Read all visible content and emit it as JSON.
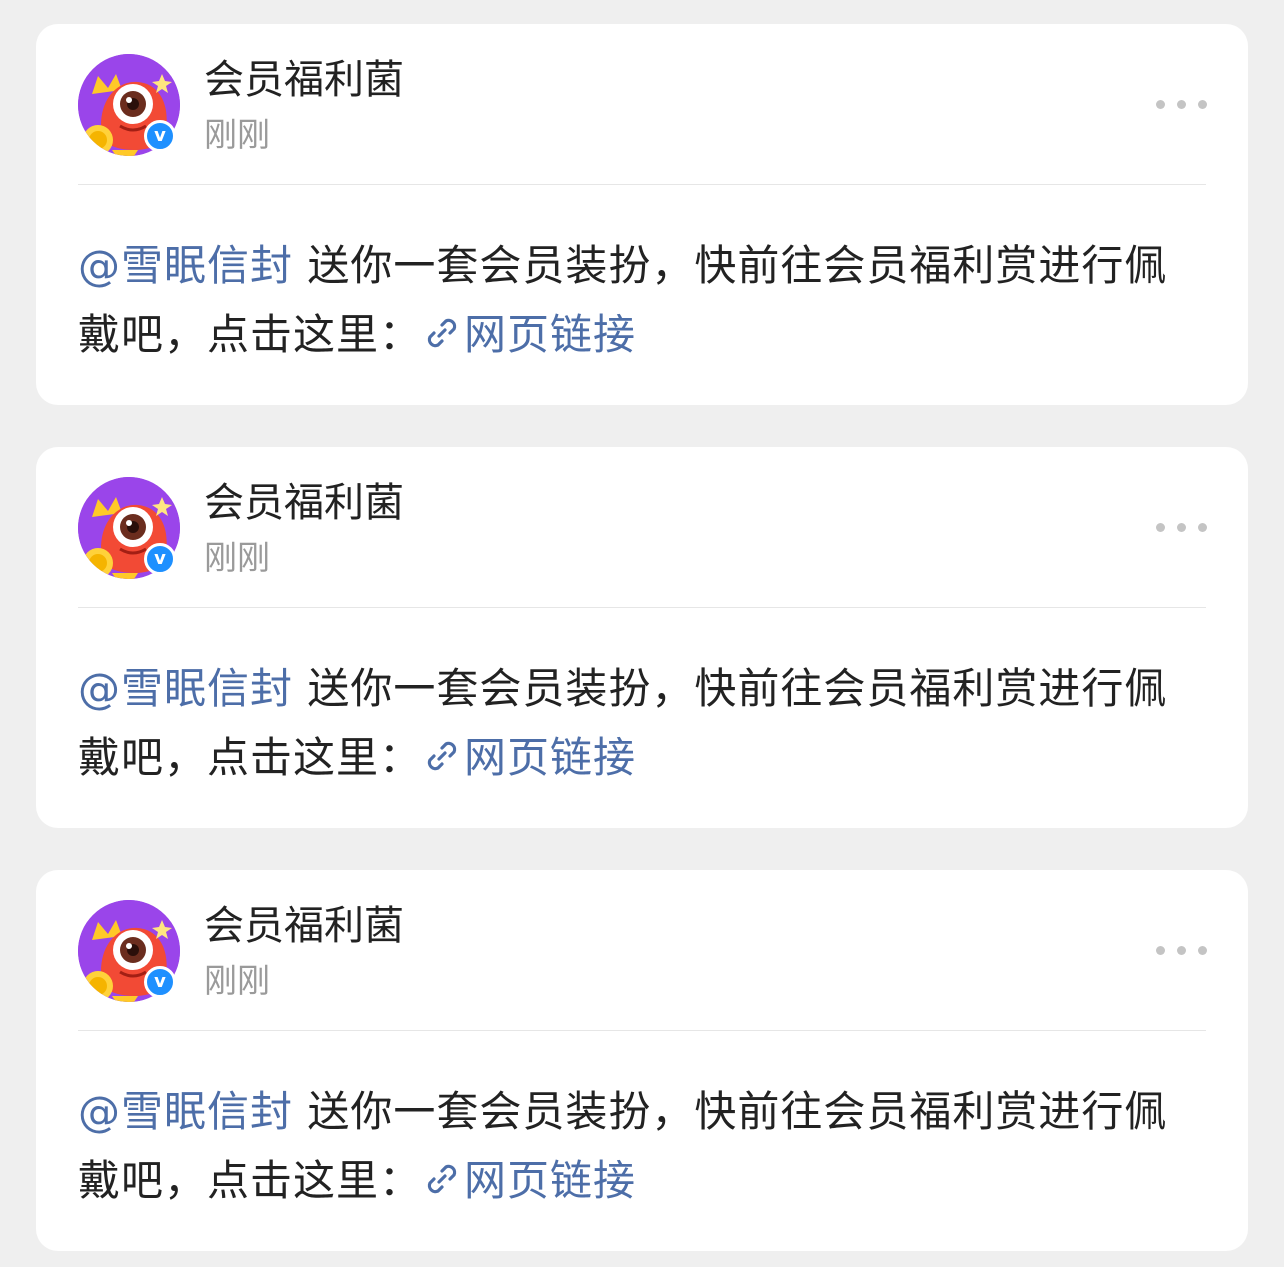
{
  "colors": {
    "background": "#efefef",
    "card": "#ffffff",
    "link": "#4d6ea8",
    "verified": "#1e90ff",
    "text_primary": "#222222",
    "text_secondary": "#9a9a9a"
  },
  "posts": [
    {
      "author": "会员福利菌",
      "time": "刚刚",
      "verified_mark": "v",
      "mention": "@雪眠信封",
      "message": " 送你一套会员装扮，快前往会员福利赏进行佩戴吧，点击这里：",
      "link_label": "网页链接",
      "link_icon": "link-icon",
      "more_icon": "more-icon"
    },
    {
      "author": "会员福利菌",
      "time": "刚刚",
      "verified_mark": "v",
      "mention": "@雪眠信封",
      "message": " 送你一套会员装扮，快前往会员福利赏进行佩戴吧，点击这里：",
      "link_label": "网页链接",
      "link_icon": "link-icon",
      "more_icon": "more-icon"
    },
    {
      "author": "会员福利菌",
      "time": "刚刚",
      "verified_mark": "v",
      "mention": "@雪眠信封",
      "message": " 送你一套会员装扮，快前往会员福利赏进行佩戴吧，点击这里：",
      "link_label": "网页链接",
      "link_icon": "link-icon",
      "more_icon": "more-icon"
    }
  ]
}
